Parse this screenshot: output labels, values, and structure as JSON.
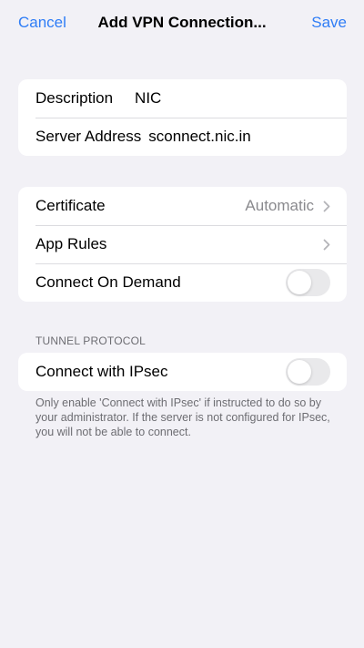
{
  "nav": {
    "cancel_label": "Cancel",
    "title": "Add VPN Connection...",
    "save_label": "Save"
  },
  "connection": {
    "description_label": "Description",
    "description_value": "NIC",
    "server_label": "Server Address",
    "server_value": "sconnect.nic.in"
  },
  "settings": {
    "certificate_label": "Certificate",
    "certificate_value": "Automatic",
    "app_rules_label": "App Rules",
    "connect_on_demand_label": "Connect On Demand",
    "connect_on_demand_on": false
  },
  "tunnel": {
    "header": "TUNNEL PROTOCOL",
    "ipsec_label": "Connect with IPsec",
    "ipsec_on": false,
    "footer": "Only enable 'Connect with IPsec' if instructed to do so by your administrator. If the server is not configured for IPsec, you will not be able to connect."
  },
  "colors": {
    "accent": "#2f7df6",
    "background": "#f2f1f6",
    "secondary_text": "#8a8a8e",
    "toggle_off": "#e9e9eb"
  },
  "icons": [
    "chevron-right-icon"
  ]
}
